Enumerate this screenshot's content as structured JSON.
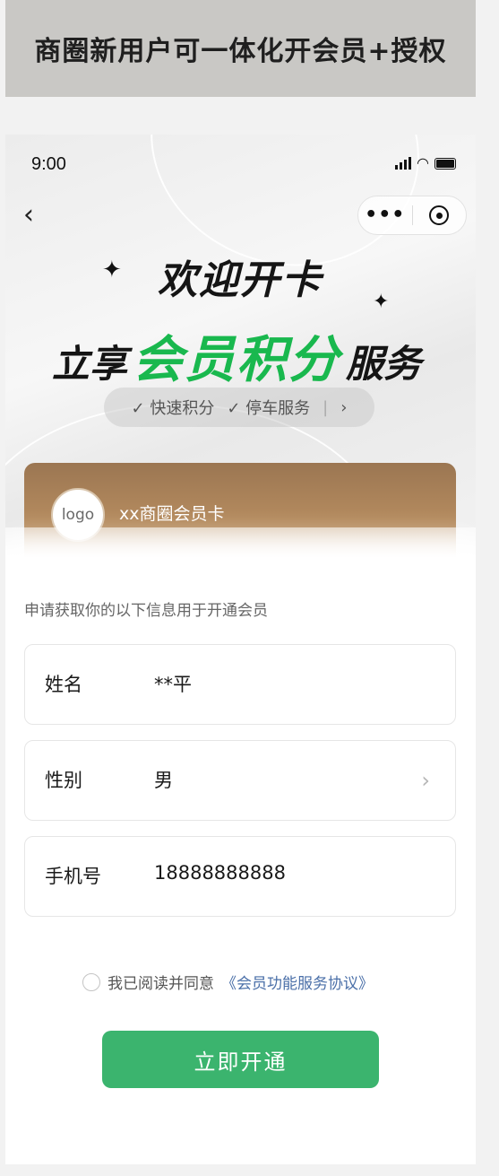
{
  "banner": {
    "title": "商圈新用户可一体化开会员+授权"
  },
  "status_bar": {
    "time": "9:00"
  },
  "nav": {
    "back_icon": "chevron-left-icon",
    "more_label": "•••",
    "close_icon": "target-icon"
  },
  "hero": {
    "welcome": "欢迎开卡",
    "headline_prefix": "立享",
    "headline_highlight": "会员积分",
    "headline_suffix": "服务",
    "sparkle": "✦",
    "features": [
      {
        "label": "✓ 快速积分"
      },
      {
        "label": "✓ 停车服务"
      }
    ],
    "features_more": "›"
  },
  "card": {
    "logo_text": "logo",
    "name": "xx商圈会员卡"
  },
  "form": {
    "description": "申请获取你的以下信息用于开通会员",
    "fields": [
      {
        "label": "姓名",
        "value": "**平"
      },
      {
        "label": "性别",
        "value": "男"
      },
      {
        "label": "手机号",
        "value": "18888888888"
      }
    ],
    "arrow": "›"
  },
  "agreement": {
    "prefix": "我已阅读并同意",
    "link": "《会员功能服务协议》"
  },
  "submit_label": "立即开通",
  "colors": {
    "accent_green": "#3bb46e",
    "headline_green": "#19b84e",
    "link_blue": "#4a6fa8",
    "card_gold": "#b68c5f"
  }
}
